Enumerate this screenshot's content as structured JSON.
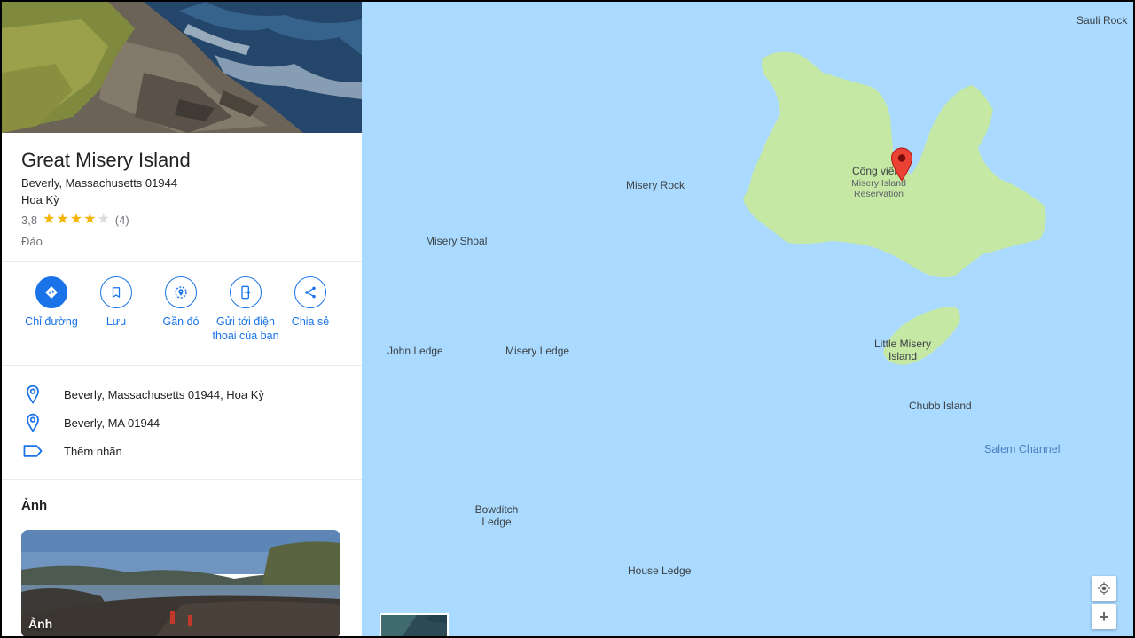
{
  "place": {
    "title": "Great Misery Island",
    "address_line1": "Beverly, Massachusetts 01944",
    "address_line2": "Hoa Kỳ",
    "rating": "3,8",
    "rating_stars": 3.8,
    "review_count": "(4)",
    "category": "Đảo"
  },
  "actions": [
    {
      "label": "Chỉ đường",
      "icon": "directions-icon"
    },
    {
      "label": "Lưu",
      "icon": "bookmark-icon"
    },
    {
      "label": "Gần đó",
      "icon": "nearby-icon"
    },
    {
      "label": "Gửi tới điện thoại của bạn",
      "icon": "send-to-phone-icon"
    },
    {
      "label": "Chia sẻ",
      "icon": "share-icon"
    }
  ],
  "info": [
    {
      "text": "Beverly, Massachusetts 01944, Hoa Kỳ",
      "icon": "location-pin-icon"
    },
    {
      "text": "Beverly, MA 01944",
      "icon": "location-pin-icon"
    },
    {
      "text": "Thêm nhãn",
      "icon": "label-icon"
    }
  ],
  "photos": {
    "heading": "Ảnh",
    "card_label": "Ảnh"
  },
  "map": {
    "labels": {
      "sauli_rock": "Sauli Rock",
      "misery_rock": "Misery Rock",
      "misery_shoal": "Misery Shoal",
      "john_ledge": "John Ledge",
      "misery_ledge": "Misery Ledge",
      "park_name": "Công viên",
      "reservation_l1": "Misery Island",
      "reservation_l2": "Reservation",
      "little_misery_l1": "Little Misery",
      "little_misery_l2": "Island",
      "chubb_island": "Chubb Island",
      "salem_channel": "Salem Channel",
      "bowditch_l1": "Bowditch",
      "bowditch_l2": "Ledge",
      "house_ledge": "House Ledge"
    },
    "colors": {
      "water": "#aadaff",
      "land": "#c5e8a5",
      "marker": "#ea4335",
      "accent": "#1a73e8"
    }
  }
}
